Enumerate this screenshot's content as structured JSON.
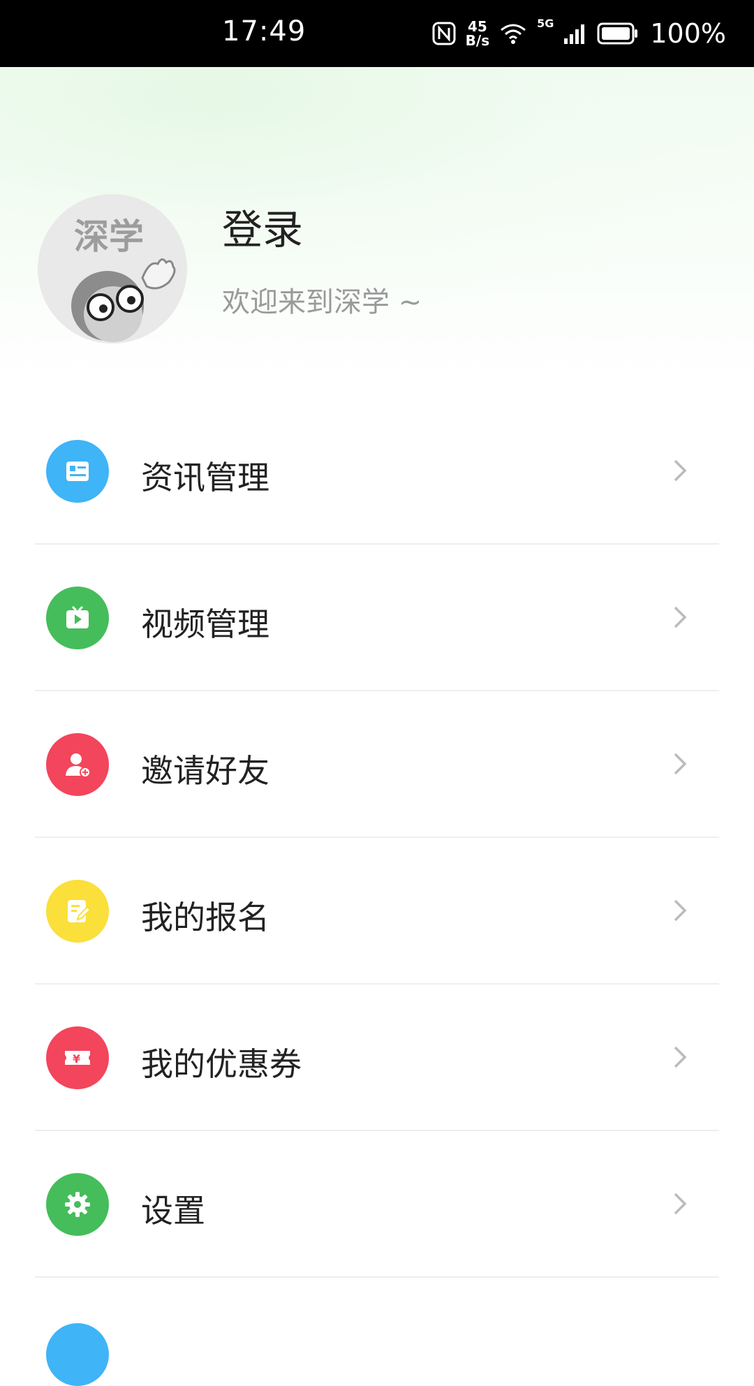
{
  "status_bar": {
    "time": "17:49",
    "speed_value": "45",
    "speed_unit": "B/s",
    "network": "5G",
    "battery": "100%",
    "icons": [
      "nfc-icon",
      "wifi-icon",
      "signal-icon",
      "battery-icon"
    ]
  },
  "profile": {
    "avatar_text": "深学",
    "login_label": "登录",
    "welcome_text": "欢迎来到深学 ~"
  },
  "menu": {
    "items": [
      {
        "label": "资讯管理",
        "icon": "news-icon",
        "color": "#3fb4f7"
      },
      {
        "label": "视频管理",
        "icon": "video-icon",
        "color": "#45bd5b"
      },
      {
        "label": "邀请好友",
        "icon": "invite-friend-icon",
        "color": "#f3455b"
      },
      {
        "label": "我的报名",
        "icon": "signup-icon",
        "color": "#fbdf3a"
      },
      {
        "label": "我的优惠券",
        "icon": "coupon-icon",
        "color": "#f3455b"
      },
      {
        "label": "设置",
        "icon": "gear-icon",
        "color": "#45bd5b"
      }
    ]
  },
  "colors": {
    "header_tint": "#e6f8e6",
    "divider": "#eeeeee",
    "chevron": "#bbbbbb"
  }
}
